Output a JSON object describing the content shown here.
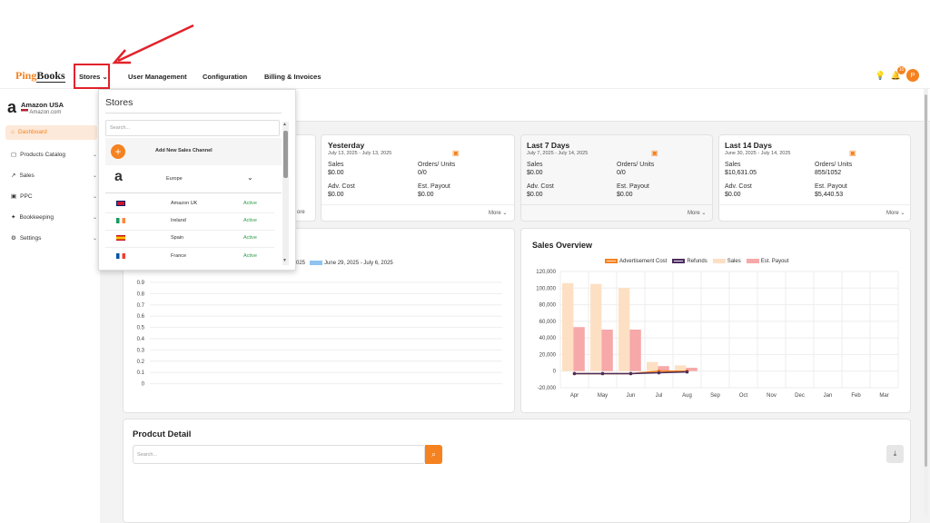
{
  "nav": {
    "logo_a": "Ping",
    "logo_b": "Books",
    "items": [
      "Stores",
      "User Management",
      "Configuration",
      "Billing & Invoices"
    ],
    "notification_count": "10",
    "avatar_letter": "P"
  },
  "sidebar": {
    "store_name": "Amazon USA",
    "store_domain": "Amazon.com",
    "items": [
      {
        "label": "Dashboard"
      },
      {
        "label": "Products Catalog"
      },
      {
        "label": "Sales"
      },
      {
        "label": "PPC"
      },
      {
        "label": "Bookkeeping"
      },
      {
        "label": "Settings"
      }
    ]
  },
  "dropdown": {
    "title": "Stores",
    "search_placeholder": "Search...",
    "add_label": "Add New Sales Channel",
    "region": "Europe",
    "stores": [
      {
        "name": "Amazon UK",
        "status": "Active"
      },
      {
        "name": "Ireland",
        "status": "Active"
      },
      {
        "name": "Spain",
        "status": "Active"
      },
      {
        "name": "France",
        "status": "Active"
      }
    ]
  },
  "cards": [
    {
      "title": "Yesterday",
      "range": "July 13, 2025 - July 13, 2025",
      "sales_label": "Sales",
      "sales": "$0.00",
      "orders_label": "Orders/ Units",
      "orders": "0/0",
      "adv_label": "Adv. Cost",
      "adv": "$0.00",
      "payout_label": "Est. Payout",
      "payout": "$0.00",
      "more": "More"
    },
    {
      "title": "Last 7 Days",
      "range": "July 7, 2025 - July 14, 2025",
      "sales_label": "Sales",
      "sales": "$0.00",
      "orders_label": "Orders/ Units",
      "orders": "0/0",
      "adv_label": "Adv. Cost",
      "adv": "$0.00",
      "payout_label": "Est. Payout",
      "payout": "$0.00",
      "more": "More"
    },
    {
      "title": "Last 14 Days",
      "range": "June 30, 2025 - July 14, 2025",
      "sales_label": "Sales",
      "sales": "$10,631.05",
      "orders_label": "Orders/ Units",
      "orders": "855/1052",
      "adv_label": "Adv. Cost",
      "adv": "$0.00",
      "payout_label": "Est. Payout",
      "payout": "$5,440.53",
      "more": "More"
    }
  ],
  "partial_card": {
    "more": "ore"
  },
  "left_chart": {
    "legend_partial": "4, 2025",
    "legend_2": "June 29, 2025 - July 6, 2025",
    "yticks": [
      "0.9",
      "0.8",
      "0.7",
      "0.6",
      "0.5",
      "0.4",
      "0.3",
      "0.2",
      "0.1",
      "0"
    ]
  },
  "product_detail": {
    "title": "Prodcut Detail",
    "search_placeholder": "Search..."
  },
  "chart_data": {
    "type": "bar",
    "title": "Sales Overview",
    "categories": [
      "Apr",
      "May",
      "Jun",
      "Jul",
      "Aug",
      "Sep",
      "Oct",
      "Nov",
      "Dec",
      "Jan",
      "Feb",
      "Mar"
    ],
    "ylim": [
      -20000,
      120000
    ],
    "yticks": [
      "120,000",
      "100,000",
      "80,000",
      "60,000",
      "40,000",
      "20,000",
      "0",
      "-20,000"
    ],
    "series": [
      {
        "name": "Advertisement Cost",
        "type": "line",
        "color": "#f58220",
        "values": [
          -3000,
          -3000,
          -3000,
          0,
          0,
          null,
          null,
          null,
          null,
          null,
          null,
          null
        ]
      },
      {
        "name": "Refunds",
        "type": "line",
        "color": "#4b2d5e",
        "values": [
          -3000,
          -3000,
          -3000,
          -2000,
          -1000,
          null,
          null,
          null,
          null,
          null,
          null,
          null
        ]
      },
      {
        "name": "Sales",
        "type": "bar",
        "color": "#fde0c4",
        "values": [
          106000,
          105000,
          100000,
          11000,
          7000,
          0,
          0,
          0,
          0,
          0,
          0,
          0
        ]
      },
      {
        "name": "Est. Payout",
        "type": "bar",
        "color": "#f7a8a8",
        "values": [
          53000,
          50000,
          50000,
          6000,
          4000,
          0,
          0,
          0,
          0,
          0,
          0,
          0
        ]
      }
    ]
  }
}
